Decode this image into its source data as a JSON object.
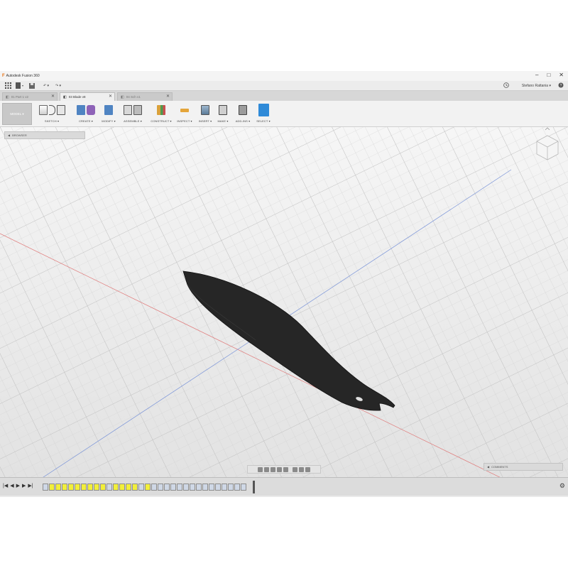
{
  "window": {
    "title": "Autodesk Fusion 360",
    "controls": [
      "–",
      "□",
      "✕"
    ]
  },
  "quick_access": {
    "grid_icon": "grid-icon",
    "file_icon": "file-icon",
    "save_icon": "save-icon",
    "undo": "↶ ▾",
    "redo": "↷ ▾"
  },
  "account": {
    "user": "Stefano Rattania ▾",
    "clock_icon": "clock-icon",
    "help_icon": "help-icon"
  },
  "tabs": [
    {
      "label": "01 Part 1 v2",
      "close": "✕",
      "active": false
    },
    {
      "label": "03 Blade v8",
      "close": "✕",
      "active": true
    },
    {
      "label": "04 Sch v1",
      "close": "✕",
      "active": false
    }
  ],
  "toolbar": {
    "workspace": "MODEL ▾",
    "groups": [
      {
        "label": "SKETCH ▾"
      },
      {
        "label": "CREATE ▾"
      },
      {
        "label": "MODIFY ▾"
      },
      {
        "label": "ASSEMBLE ▾"
      },
      {
        "label": "CONSTRUCT ▾"
      },
      {
        "label": "INSPECT ▾"
      },
      {
        "label": "INSERT ▾"
      },
      {
        "label": "MAKE ▾"
      },
      {
        "label": "ADD-INS ▾"
      },
      {
        "label": "SELECT ▾"
      }
    ]
  },
  "browser": {
    "label": "BROWSER"
  },
  "comments": {
    "label": "COMMENTS"
  },
  "timeline": {
    "controls": [
      "|◀",
      "◀",
      "▶",
      "▶",
      "▶|"
    ],
    "settings_icon": "⚙"
  },
  "colors": {
    "accent_select": "#2f8ad8",
    "timeline_highlight": "#f2ef3a",
    "blade": "#262626"
  }
}
